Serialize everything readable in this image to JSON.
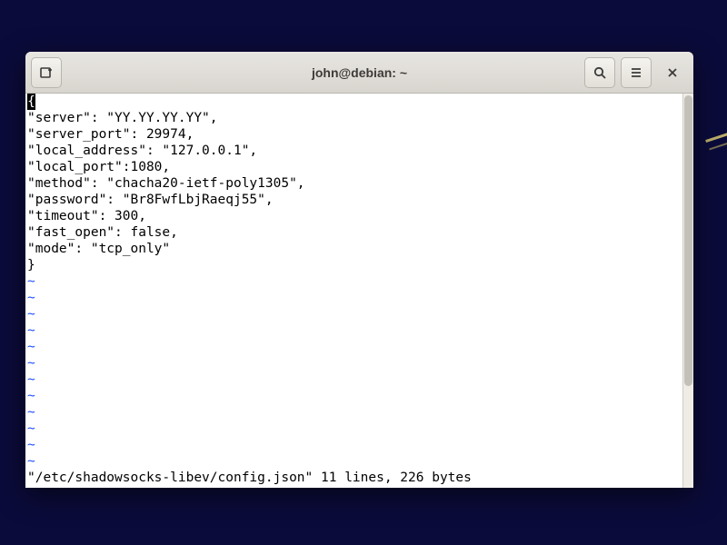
{
  "window": {
    "title": "john@debian: ~"
  },
  "editor": {
    "cursor_char": "{",
    "lines": [
      "\"server\": \"YY.YY.YY.YY\",",
      "\"server_port\": 29974,",
      "\"local_address\": \"127.0.0.1\",",
      "\"local_port\":1080,",
      "\"method\": \"chacha20-ietf-poly1305\",",
      "\"password\": \"Br8FwfLbjRaeqj55\",",
      "\"timeout\": 300,",
      "\"fast_open\": false,",
      "\"mode\": \"tcp_only\"",
      "}"
    ],
    "empty_line_marker": "~",
    "empty_line_count": 12,
    "status_line": "\"/etc/shadowsocks-libev/config.json\" 11 lines, 226 bytes"
  }
}
